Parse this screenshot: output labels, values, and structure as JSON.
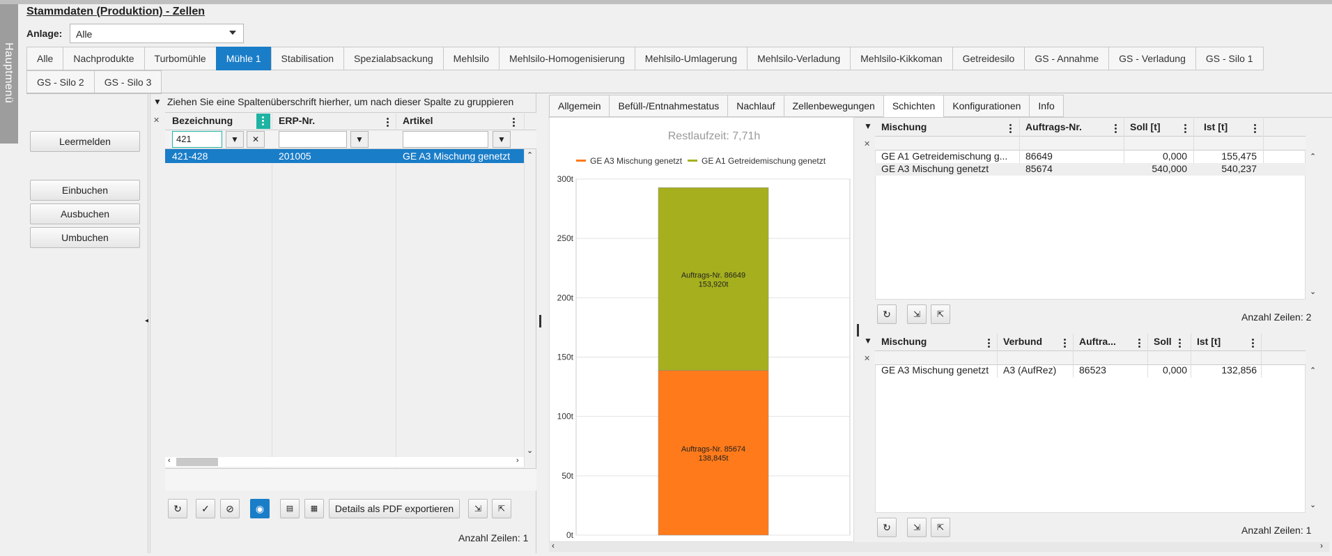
{
  "app": {
    "menu_label": "Hauptmenü",
    "title": "Stammdaten (Produktion) - Zellen"
  },
  "anlage": {
    "label": "Anlage:",
    "value": "Alle"
  },
  "main_tabs": [
    {
      "label": "Alle"
    },
    {
      "label": "Nachprodukte"
    },
    {
      "label": "Turbomühle"
    },
    {
      "label": "Mühle 1",
      "active": true
    },
    {
      "label": "Stabilisation"
    },
    {
      "label": "Spezialabsackung"
    },
    {
      "label": "Mehlsilo"
    },
    {
      "label": "Mehlsilo-Homogenisierung"
    },
    {
      "label": "Mehlsilo-Umlagerung"
    },
    {
      "label": "Mehlsilo-Verladung"
    },
    {
      "label": "Mehlsilo-Kikkoman"
    },
    {
      "label": "Getreidesilo"
    },
    {
      "label": "GS - Annahme"
    },
    {
      "label": "GS - Verladung"
    },
    {
      "label": "GS - Silo 1"
    },
    {
      "label": "GS - Silo 2"
    },
    {
      "label": "GS - Silo 3"
    }
  ],
  "actions": {
    "leermelden": "Leermelden",
    "einbuchen": "Einbuchen",
    "ausbuchen": "Ausbuchen",
    "umbuchen": "Umbuchen"
  },
  "grid": {
    "group_hint": "Ziehen Sie eine Spaltenüberschrift hierher, um nach dieser Spalte zu gruppieren",
    "columns": [
      "Bezeichnung",
      "ERP-Nr.",
      "Artikel"
    ],
    "filter_value": "421",
    "rows": [
      {
        "bezeichnung": "421-428",
        "erp": "201005",
        "artikel": "GE A3 Mischung genetzt"
      }
    ],
    "export_label": "Details als PDF exportieren",
    "count_label": "Anzahl Zeilen: 1"
  },
  "subtabs": [
    {
      "label": "Allgemein"
    },
    {
      "label": "Befüll-/Entnahmestatus"
    },
    {
      "label": "Nachlauf"
    },
    {
      "label": "Zellenbewegungen"
    },
    {
      "label": "Schichten",
      "active": true
    },
    {
      "label": "Konfigurationen"
    },
    {
      "label": "Info"
    }
  ],
  "chart_data": {
    "type": "bar",
    "title": "Restlaufzeit: 7,71h",
    "stacked": true,
    "categories": [
      ""
    ],
    "series": [
      {
        "name": "GE A3 Mischung genetzt",
        "color": "#ff7a1a",
        "values": [
          138.845
        ],
        "label_line1": "Auftrags-Nr. 85674",
        "label_line2": "138,845t"
      },
      {
        "name": "GE A1 Getreidemischung genetzt",
        "color": "#a6b01e",
        "values": [
          153.92
        ],
        "label_line1": "Auftrags-Nr. 86649",
        "label_line2": "153,920t"
      }
    ],
    "ylim": [
      0,
      300
    ],
    "yticks": [
      "0t",
      "50t",
      "100t",
      "150t",
      "200t",
      "250t",
      "300t"
    ],
    "legend_position": "top"
  },
  "schichten": {
    "columns": [
      "Mischung",
      "Auftrags-Nr.",
      "Soll [t]",
      "Ist [t]"
    ],
    "rows": [
      {
        "mischung": "GE A1 Getreidemischung g...",
        "auftrag": "86649",
        "soll": "0,000",
        "ist": "155,475"
      },
      {
        "mischung": "GE A3 Mischung genetzt",
        "auftrag": "85674",
        "soll": "540,000",
        "ist": "540,237"
      }
    ],
    "count_label": "Anzahl Zeilen: 2"
  },
  "verbund": {
    "columns": [
      "Mischung",
      "Verbund",
      "Auftra...",
      "Soll",
      "Ist [t]"
    ],
    "rows": [
      {
        "mischung": "GE A3 Mischung genetzt",
        "verbund": "A3 (AufRez)",
        "auftrag": "86523",
        "soll": "0,000",
        "ist": "132,856"
      }
    ],
    "count_label": "Anzahl Zeilen: 1"
  }
}
